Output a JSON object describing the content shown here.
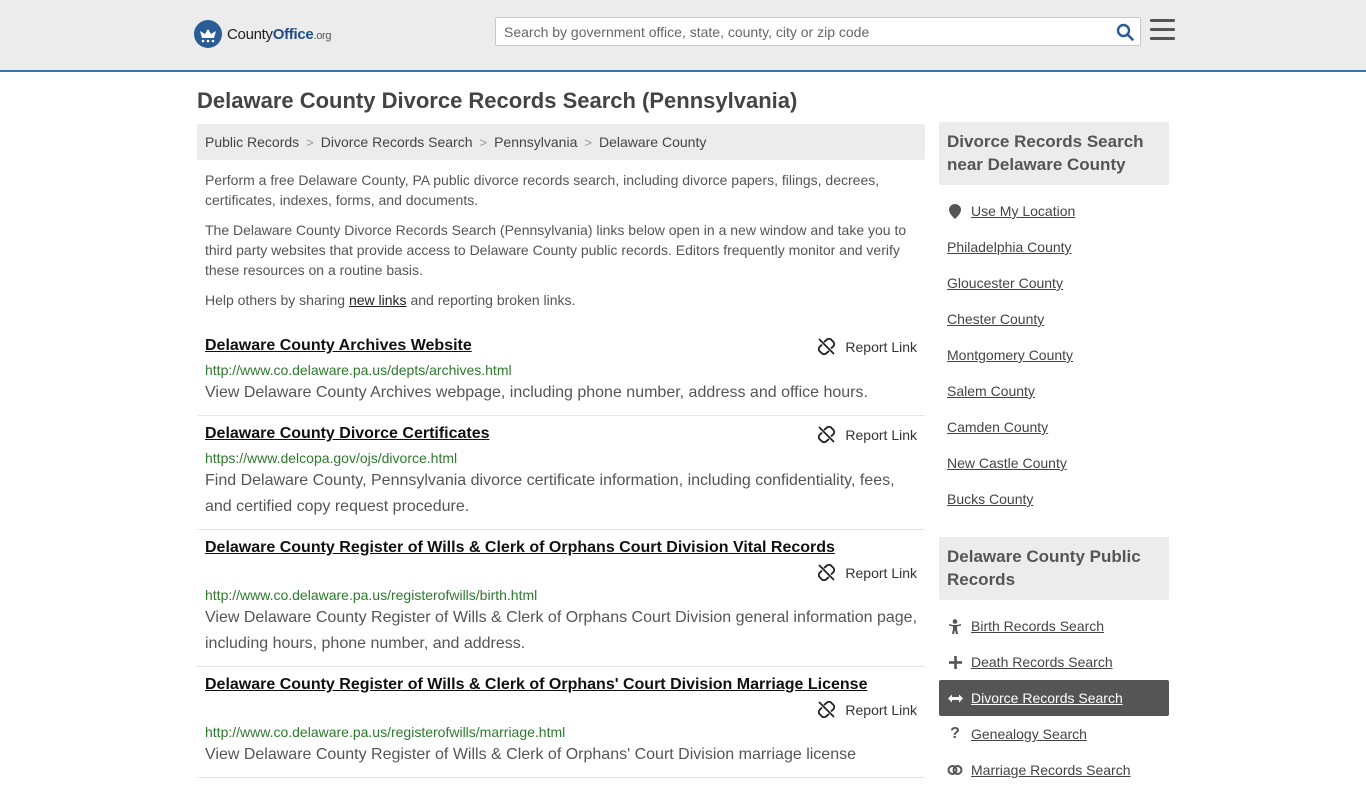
{
  "header": {
    "logo_main": "County",
    "logo_accent": "Office",
    "logo_tld": ".org",
    "search_placeholder": "Search by government office, state, county, city or zip code"
  },
  "page_title": "Delaware County Divorce Records Search (Pennsylvania)",
  "breadcrumb": [
    "Public Records",
    "Divorce Records Search",
    "Pennsylvania",
    "Delaware County"
  ],
  "intro": {
    "p1": "Perform a free Delaware County, PA public divorce records search, including divorce papers, filings, decrees, certificates, indexes, forms, and documents.",
    "p2": "The Delaware County Divorce Records Search (Pennsylvania) links below open in a new window and take you to third party websites that provide access to Delaware County public records. Editors frequently monitor and verify these resources on a routine basis.",
    "p3_before": "Help others by sharing ",
    "p3_link": "new links",
    "p3_after": " and reporting broken links."
  },
  "report_label": "Report Link",
  "results": [
    {
      "title": "Delaware County Archives Website",
      "url": "http://www.co.delaware.pa.us/depts/archives.html",
      "desc": "View Delaware County Archives webpage, including phone number, address and office hours."
    },
    {
      "title": "Delaware County Divorce Certificates",
      "url": "https://www.delcopa.gov/ojs/divorce.html",
      "desc": "Find Delaware County, Pennsylvania divorce certificate information, including confidentiality, fees, and certified copy request procedure."
    },
    {
      "title": "Delaware County Register of Wills & Clerk of Orphans Court Division Vital Records",
      "url": "http://www.co.delaware.pa.us/registerofwills/birth.html",
      "desc": "View Delaware County Register of Wills & Clerk of Orphans Court Division general information page, including hours, phone number, and address."
    },
    {
      "title": "Delaware County Register of Wills & Clerk of Orphans' Court Division Marriage License",
      "url": "http://www.co.delaware.pa.us/registerofwills/marriage.html",
      "desc": "View Delaware County Register of Wills & Clerk of Orphans' Court Division marriage license"
    }
  ],
  "sidebar": {
    "nearby_title": "Divorce Records Search near Delaware County",
    "use_location": "Use My Location",
    "nearby": [
      "Philadelphia County",
      "Gloucester County",
      "Chester County",
      "Montgomery County",
      "Salem County",
      "Camden County",
      "New Castle County",
      "Bucks County"
    ],
    "records_title": "Delaware County Public Records",
    "records": [
      {
        "label": "Birth Records Search",
        "icon": "child-icon"
      },
      {
        "label": "Death Records Search",
        "icon": "cross-icon"
      },
      {
        "label": "Divorce Records Search",
        "icon": "arrows-horizontal-icon",
        "active": true
      },
      {
        "label": "Genealogy Search",
        "icon": "question-icon"
      },
      {
        "label": "Marriage Records Search",
        "icon": "rings-icon"
      }
    ]
  },
  "colors": {
    "header_bg": "#ececec",
    "header_border": "#3a6ea5",
    "url_green": "#2d7a2d",
    "active_bg": "#555555",
    "logo_blue": "#2a5d95"
  }
}
